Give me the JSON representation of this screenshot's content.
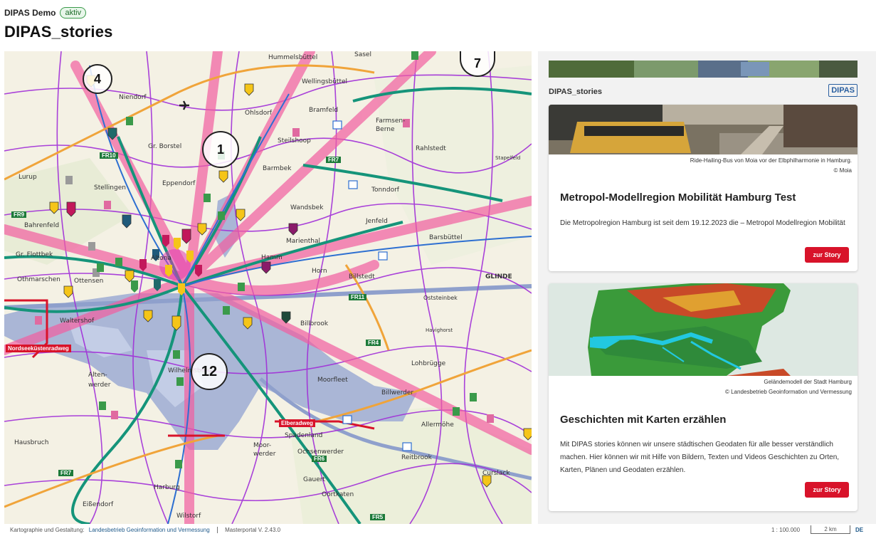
{
  "header": {
    "app_name": "DIPAS Demo",
    "status_badge": "aktiv",
    "page_title": "DIPAS_stories"
  },
  "map": {
    "place_labels": [
      "Hummelsbüttel",
      "Niendorf",
      "Wellingsbüttel",
      "Ohlsdorf",
      "Bramfeld",
      "Farmsen-Berne",
      "Steilshoop",
      "Rahlstedt",
      "Gr. Borstel",
      "Lurup",
      "Stellingen",
      "Barmbek",
      "Eppendorf",
      "Tonndorf",
      "Bahrenfeld",
      "Wandsbek",
      "Jenfeld",
      "Barsbüttel",
      "Gr. Flottbek",
      "Marienthal",
      "Hamm",
      "Othmarschen",
      "Horn",
      "Billstedt",
      "GLINDE",
      "Oststeinbek",
      "Waltershof",
      "Billbrook",
      "Alten-werder",
      "Moorfleet",
      "Billwerder",
      "Lohbrügge",
      "Wilhelmsburg",
      "Hausbruch",
      "Spadenland",
      "Ochsenwerder",
      "Moor-werder",
      "Allermöhe",
      "Reitbrook",
      "Curslack",
      "Gauert",
      "Oortkaten",
      "Harburg",
      "Eißendorf",
      "Wilstorf",
      "Sasel",
      "Altona",
      "Ottensen",
      "Stapelfeld",
      "Havighorst"
    ],
    "route_tags": [
      "Nordseeküstenradweg",
      "Elberadweg"
    ],
    "cluster_counts": [
      "4",
      "7",
      "1",
      "12"
    ],
    "freeway_tags": [
      "FR7",
      "FR9",
      "FR10",
      "FR11",
      "FR4",
      "FR5",
      "FR6",
      "FR7"
    ]
  },
  "sidebar": {
    "banner_caption": "",
    "brand_title": "DIPAS_stories",
    "brand_logo": "DIPAS",
    "stories": [
      {
        "image_caption_1": "Ride-Hailing-Bus von Moia vor der Elbphilharmonie in Hamburg.",
        "image_caption_2": "© Moia",
        "title": "Metropol-Modellregion Mobilität Hamburg Test",
        "description": "Die Metropolregion Hamburg ist seit dem 19.12.2023 die – Metropol Modellregion Mobilität",
        "button_label": "zur Story"
      },
      {
        "image_caption_1": "Geländemodell der Stadt Hamburg",
        "image_caption_2": "© Landesbetrieb Geoinformation und Vermessung",
        "title": "Geschichten mit Karten erzählen",
        "description": "Mit DIPAS stories können wir unsere städtischen Geodaten für alle besser verständlich machen. Hier können wir mit Hilfe von Bildern, Texten und Videos Geschichten zu Orten, Karten, Plänen und Geodaten erzählen.",
        "button_label": "zur Story"
      }
    ]
  },
  "footer": {
    "credit_prefix": "Kartographie und Gestaltung:",
    "credit_link": "Landesbetrieb Geoinformation und Vermessung",
    "version": "Masterportal V. 2.43.0",
    "scale": "1 : 100.000",
    "scale_bar": "2 km",
    "language": "DE"
  },
  "colors": {
    "accent_red": "#d8132a",
    "badge_green": "#3a9a4a",
    "map_pink": "#f25ea0",
    "map_purple": "#9a2bd6",
    "map_green": "#1e9a6a"
  }
}
